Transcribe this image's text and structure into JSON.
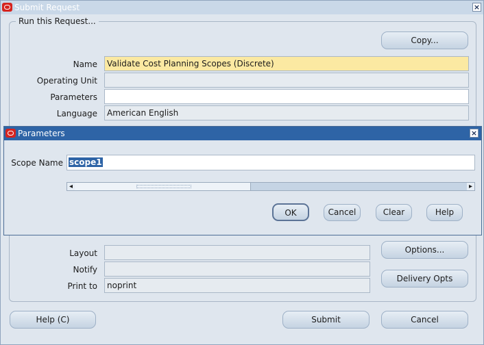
{
  "window": {
    "title": "Submit Request",
    "close_glyph": "×"
  },
  "run_group": {
    "legend": "Run this Request...",
    "copy_button": "Copy...",
    "name_label": "Name",
    "name_value": "Validate Cost Planning Scopes (Discrete)",
    "operating_unit_label": "Operating Unit",
    "operating_unit_value": "",
    "parameters_label": "Parameters",
    "parameters_value": "",
    "language_label": "Language",
    "language_value": "American English"
  },
  "parameters_dialog": {
    "title": "Parameters",
    "close_glyph": "×",
    "scope_name_label": "Scope Name",
    "scope_name_value": "scope1",
    "ok_button": "OK",
    "cancel_button": "Cancel",
    "clear_button": "Clear",
    "help_button": "Help",
    "scroll_left": "◂",
    "scroll_right": "▸"
  },
  "output_group": {
    "layout_label": "Layout",
    "layout_value": "",
    "notify_label": "Notify",
    "notify_value": "",
    "print_to_label": "Print to",
    "print_to_value": "noprint",
    "options_button": "Options...",
    "delivery_button": "Delivery Opts"
  },
  "footer": {
    "help_button": "Help (C)",
    "submit_button": "Submit",
    "cancel_button": "Cancel"
  },
  "colors": {
    "titlebar_active": "#2e64a6",
    "titlebar_inactive": "#c9d8e8",
    "oracle_red": "#d6241f",
    "required_field": "#fbe9a2"
  }
}
